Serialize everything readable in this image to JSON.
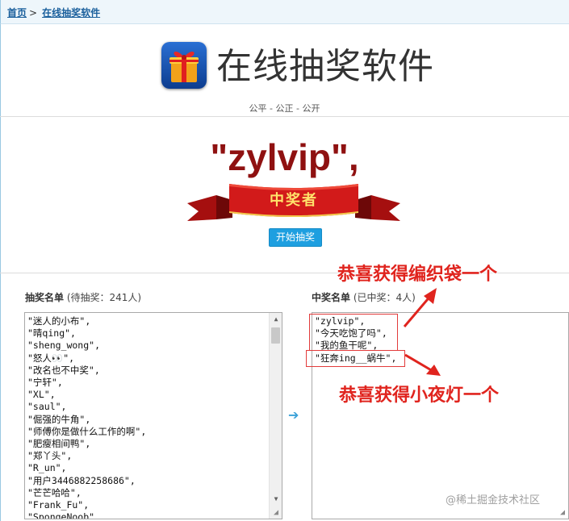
{
  "breadcrumb": {
    "home": "首页",
    "separator": ">",
    "current": "在线抽奖软件"
  },
  "header": {
    "app_title": "在线抽奖软件",
    "tagline": "公平 - 公正 - 公开"
  },
  "winner": {
    "display": "\"zylvip\",",
    "ribbon_label": "中奖者"
  },
  "actions": {
    "start_label": "开始抽奖"
  },
  "candidates": {
    "title": "抽奖名单",
    "status": "(待抽奖：241人)",
    "items": [
      "\"迷人的小布\",",
      "\"晴qing\",",
      "\"sheng_wong\",",
      "\"怒人👀\",",
      "\"改名也不中奖\",",
      "\"宁轩\",",
      "\"XL\",",
      "\"saul\",",
      "\"倔强的牛角\",",
      "\"师傅你是做什么工作的啊\",",
      "\"肥瘦相间鸭\",",
      "\"郑丫头\",",
      "\"R_un\",",
      "\"用户3446882258686\",",
      "\"芒芒哈哈\",",
      "\"Frank_Fu\",",
      "\"SpongeNoob\","
    ]
  },
  "winners": {
    "title": "中奖名单",
    "status": "(已中奖：4人)",
    "items": [
      "\"zylvip\",",
      "\"今天吃饱了吗\",",
      "\"我的鱼干呢\",",
      "\"狂奔ing__蜗牛\","
    ]
  },
  "annotations": {
    "top": "恭喜获得编织袋一个",
    "bottom": "恭喜获得小夜灯一个"
  },
  "watermark": "@稀土掘金技术社区",
  "colors": {
    "winner_text": "#8f1111",
    "start_button": "#1e9fe0",
    "annotation": "#e0241e",
    "link": "#1a5f9c"
  }
}
